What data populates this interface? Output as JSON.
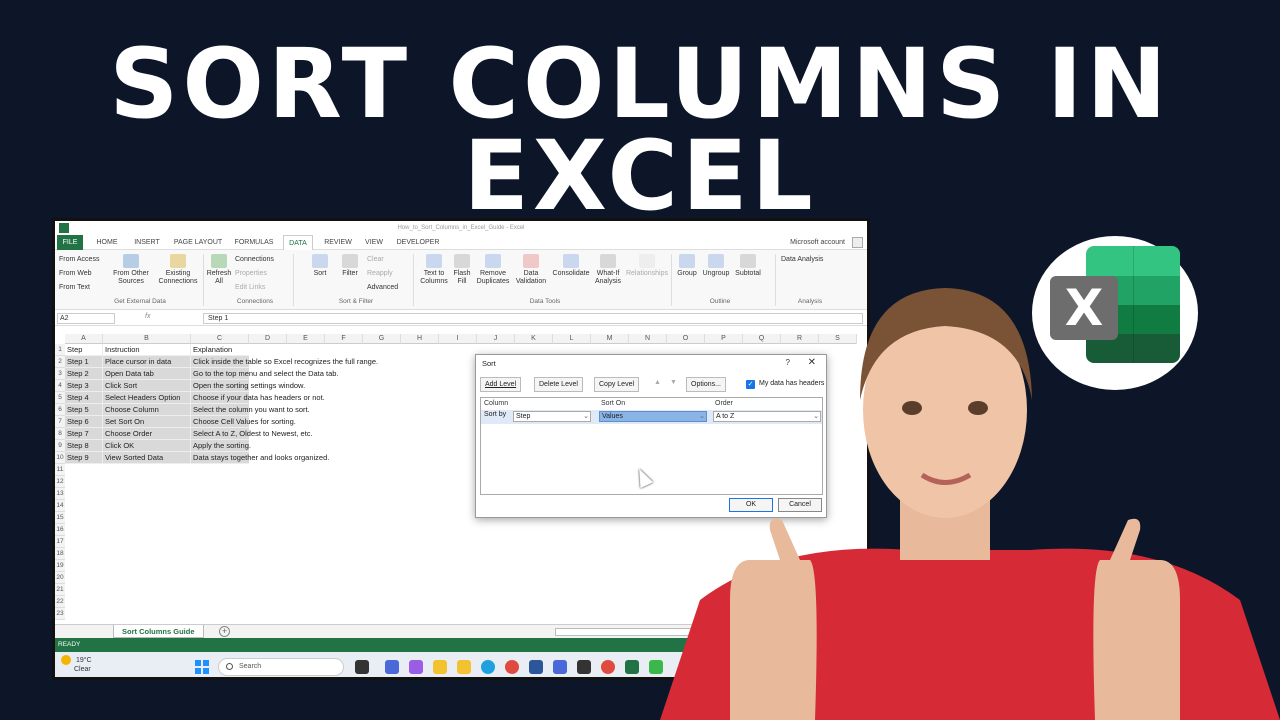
{
  "headline": {
    "line1": "SORT COLUMNS IN",
    "line2": "EXCEL"
  },
  "excel": {
    "window_title": "How_to_Sort_Columns_in_Excel_Guide - Excel",
    "tabs": [
      "FILE",
      "HOME",
      "INSERT",
      "PAGE LAYOUT",
      "FORMULAS",
      "DATA",
      "REVIEW",
      "VIEW",
      "DEVELOPER"
    ],
    "active_tab": "DATA",
    "account": "Microsoft account",
    "ribbon": {
      "from_access": "From Access",
      "from_web": "From Web",
      "from_text": "From Text",
      "from_other": "From Other",
      "from_other_2": "Sources",
      "existing": "Existing",
      "existing_2": "Connections",
      "group_external": "Get External Data",
      "refresh": "Refresh",
      "refresh_2": "All",
      "connections": "Connections",
      "properties": "Properties",
      "edit_links": "Edit Links",
      "group_connections": "Connections",
      "sort": "Sort",
      "filter": "Filter",
      "clear": "Clear",
      "reapply": "Reapply",
      "advanced": "Advanced",
      "group_sortfilter": "Sort & Filter",
      "text_to": "Text to",
      "text_to_2": "Columns",
      "flash": "Flash",
      "flash_2": "Fill",
      "remove": "Remove",
      "remove_2": "Duplicates",
      "data_val": "Data",
      "data_val_2": "Validation",
      "consolidate": "Consolidate",
      "whatif": "What-If",
      "whatif_2": "Analysis",
      "relationships": "Relationships",
      "group_datatools": "Data Tools",
      "group": "Group",
      "ungroup": "Ungroup",
      "subtotal": "Subtotal",
      "group_outline": "Outline",
      "data_analysis": "Data Analysis",
      "group_analysis": "Analysis"
    },
    "name_box": "A2",
    "fx": "fx",
    "formula_value": "Step 1",
    "columns": [
      "A",
      "B",
      "C",
      "D",
      "E",
      "F",
      "G",
      "H",
      "I",
      "J",
      "K",
      "L",
      "M",
      "N",
      "O",
      "P",
      "Q",
      "R",
      "S"
    ],
    "rows": [
      [
        "Step",
        "Instruction",
        "Explanation"
      ],
      [
        "Step 1",
        "Place cursor in data",
        "Click inside the table so Excel recognizes the full range."
      ],
      [
        "Step 2",
        "Open Data tab",
        "Go to the top menu and select the Data tab."
      ],
      [
        "Step 3",
        "Click Sort",
        "Open the sorting settings window."
      ],
      [
        "Step 4",
        "Select Headers Option",
        "Choose if your data has headers or not."
      ],
      [
        "Step 5",
        "Choose Column",
        "Select the column you want to sort."
      ],
      [
        "Step 6",
        "Set Sort On",
        "Choose Cell Values for sorting."
      ],
      [
        "Step 7",
        "Choose Order",
        "Select A to Z, Oldest to Newest, etc."
      ],
      [
        "Step 8",
        "Click OK",
        "Apply the sorting."
      ],
      [
        "Step 9",
        "View Sorted Data",
        "Data stays together and looks organized."
      ]
    ],
    "row_numbers": [
      "1",
      "2",
      "3",
      "4",
      "5",
      "6",
      "7",
      "8",
      "9",
      "10",
      "11",
      "12",
      "13",
      "14",
      "15",
      "16",
      "17",
      "18",
      "19",
      "20",
      "21",
      "22",
      "23"
    ],
    "sheet_tab": "Sort Columns Guide",
    "status": "READY",
    "taskbar": {
      "temp": "19°C",
      "weather": "Clear",
      "search": "Search"
    }
  },
  "sort_dialog": {
    "title": "Sort",
    "help": "?",
    "close": "✕",
    "add_level": "Add Level",
    "delete_level": "Delete Level",
    "copy_level": "Copy Level",
    "options": "Options...",
    "headers_label": "My data has headers",
    "headers_checked": true,
    "col_header": "Column",
    "sorton_header": "Sort On",
    "order_header": "Order",
    "sort_by": "Sort by",
    "column_value": "Step",
    "sorton_value": "Values",
    "order_value": "A to Z",
    "ok": "OK",
    "cancel": "Cancel"
  },
  "colors": {
    "excel_green": "#217346",
    "background": "#0d1628",
    "shirt": "#d62b36"
  },
  "icons": [
    "excel-logo-icon",
    "search-icon",
    "windows-start-icon",
    "mouse-cursor-icon"
  ]
}
